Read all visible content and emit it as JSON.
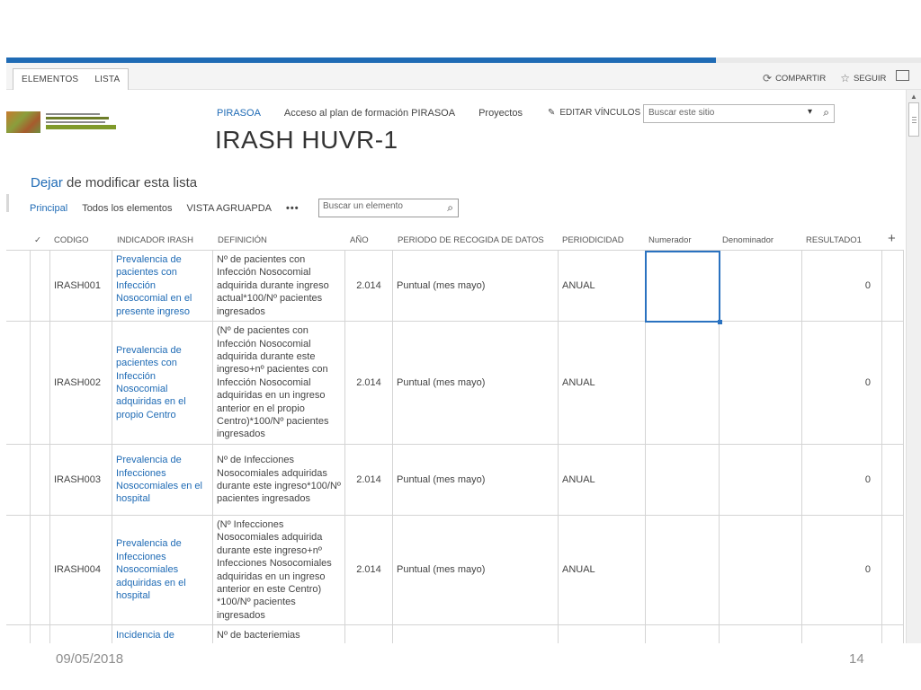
{
  "ribbon": {
    "tabs": [
      "ELEMENTOS",
      "LISTA"
    ],
    "share": "COMPARTIR",
    "follow": "SEGUIR"
  },
  "nav": {
    "items": [
      "PIRASOA",
      "Acceso al plan de formación PIRASOA",
      "Proyectos"
    ],
    "edit_links": "EDITAR VÍNCULOS",
    "site_search_placeholder": "Buscar este sitio"
  },
  "site_title": "IRASH HUVR-1",
  "stop_edit": {
    "link": "Dejar",
    "rest": " de modificar esta lista"
  },
  "views": {
    "items": [
      "Principal",
      "Todos los elementos",
      "VISTA AGRUAPDA"
    ],
    "more": "•••",
    "item_search_placeholder": "Buscar un elemento"
  },
  "table": {
    "check": "✓",
    "headers": [
      "CODIGO",
      "INDICADOR IRASH",
      "DEFINICIÓN",
      "AÑO",
      "PERIODO DE RECOGIDA DE DATOS",
      "PERIODICIDAD",
      "Numerador",
      "Denominador",
      "RESULTADO1"
    ],
    "add": "+",
    "rows": [
      {
        "codigo": "IRASH001",
        "indicador": "Prevalencia de pacientes con Infección Nosocomial en el presente ingreso",
        "definicion": "Nº de pacientes con Infección Nosocomial adquirida durante ingreso actual*100/Nº pacientes ingresados",
        "anio": "2.014",
        "periodo": "Puntual (mes mayo)",
        "periodicidad": "ANUAL",
        "numerador": "",
        "denominador": "",
        "resultado": "0"
      },
      {
        "codigo": "IRASH002",
        "indicador": "Prevalencia de pacientes con Infección Nosocomial adquiridas en el propio Centro",
        "definicion": "(Nº de pacientes con Infección Nosocomial adquirida durante este ingreso+nº pacientes con Infección Nosocomial adquiridas en un ingreso anterior en el propio Centro)*100/Nº pacientes ingresados",
        "anio": "2.014",
        "periodo": "Puntual (mes mayo)",
        "periodicidad": "ANUAL",
        "numerador": "",
        "denominador": "",
        "resultado": "0"
      },
      {
        "codigo": "IRASH003",
        "indicador": "Prevalencia de Infecciones Nosocomiales en el hospital",
        "definicion": "Nº de Infecciones Nosocomiales adquiridas durante este ingreso*100/Nº pacientes ingresados",
        "anio": "2.014",
        "periodo": "Puntual (mes mayo)",
        "periodicidad": "ANUAL",
        "numerador": "",
        "denominador": "",
        "resultado": "0"
      },
      {
        "codigo": "IRASH004",
        "indicador": "Prevalencia de Infecciones Nosocomiales adquiridas en el hospital",
        "definicion": "(Nº Infecciones Nosocomiales adquirida durante este ingreso+nº Infecciones Nosocomiales adquiridas en un ingreso anterior en este Centro) *100/Nº pacientes ingresados",
        "anio": "2.014",
        "periodo": "Puntual (mes mayo)",
        "periodicidad": "ANUAL",
        "numerador": "",
        "denominador": "",
        "resultado": "0"
      },
      {
        "codigo": "",
        "indicador": "Incidencia de",
        "definicion": "Nº de bacteriemias",
        "anio": "",
        "periodo": "",
        "periodicidad": "",
        "numerador": "",
        "denominador": "",
        "resultado": ""
      }
    ]
  },
  "footer": {
    "date": "09/05/2018",
    "page": "14"
  },
  "colors": {
    "accent": "#1f6bb5",
    "text": "#444444",
    "grid_line": "#d4d4d4"
  }
}
